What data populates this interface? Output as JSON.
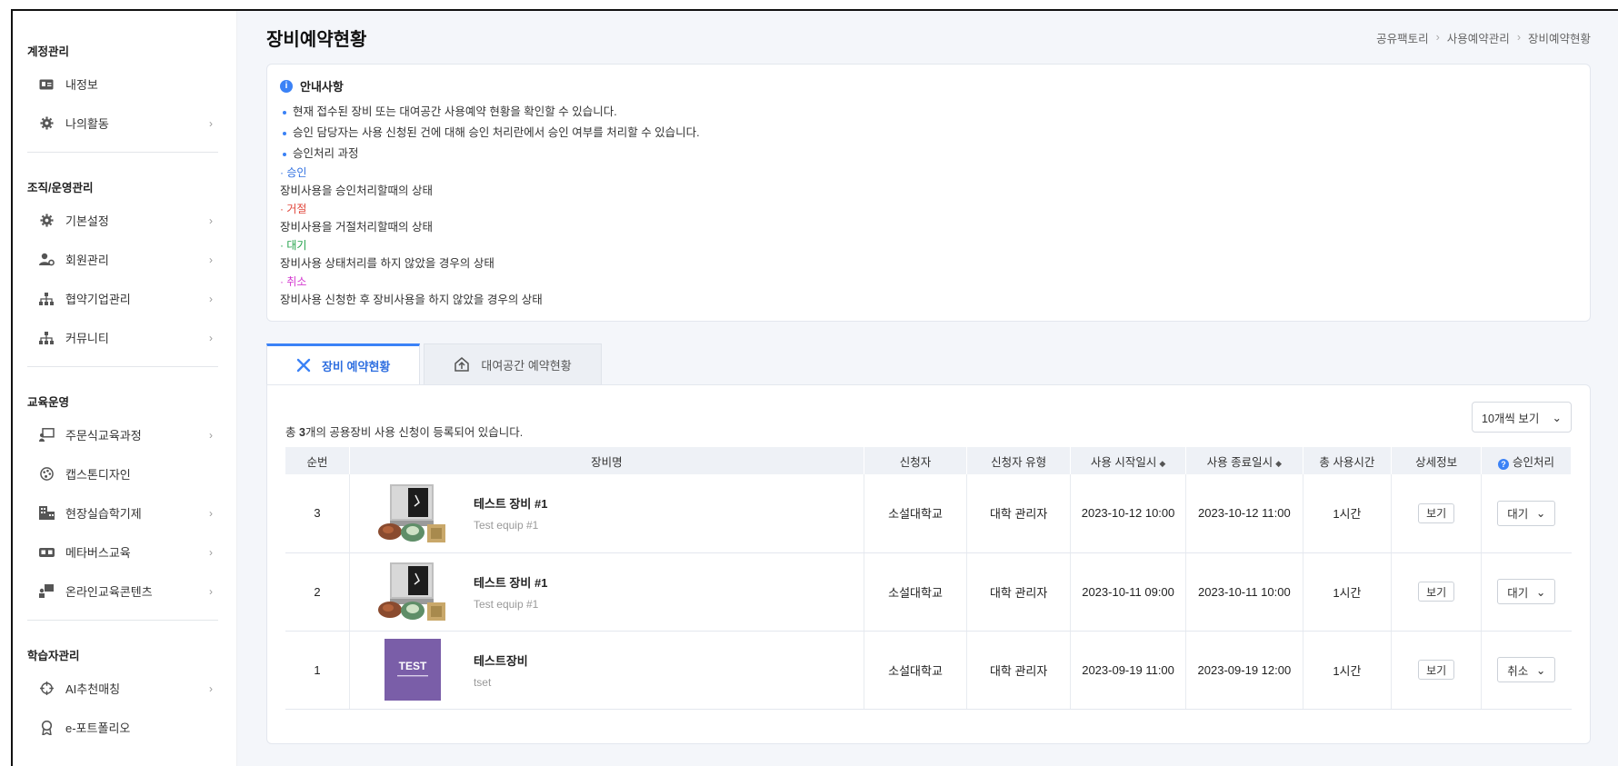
{
  "sidebar": {
    "sections": [
      {
        "heading": "계정관리",
        "items": [
          {
            "label": "내정보",
            "icon": "id-card-icon"
          },
          {
            "label": "나의활동",
            "icon": "gear-icon"
          }
        ]
      },
      {
        "heading": "조직/운영관리",
        "items": [
          {
            "label": "기본설정",
            "icon": "gear-icon"
          },
          {
            "label": "회원관리",
            "icon": "user-gear-icon"
          },
          {
            "label": "협약기업관리",
            "icon": "org-chart-icon"
          },
          {
            "label": "커뮤니티",
            "icon": "org-chart-icon"
          }
        ]
      },
      {
        "heading": "교육운영",
        "items": [
          {
            "label": "주문식교육과정",
            "icon": "presentation-icon"
          },
          {
            "label": "캡스톤디자인",
            "icon": "palette-icon"
          },
          {
            "label": "현장실습학기제",
            "icon": "building-icon"
          },
          {
            "label": "메타버스교육",
            "icon": "vr-goggles-icon"
          },
          {
            "label": "온라인교육콘텐츠",
            "icon": "user-board-icon"
          }
        ]
      },
      {
        "heading": "학습자관리",
        "items": [
          {
            "label": "AI추천매칭",
            "icon": "crosshair-icon"
          },
          {
            "label": "e-포트폴리오",
            "icon": "medal-icon"
          }
        ]
      }
    ]
  },
  "header": {
    "title": "장비예약현황",
    "breadcrumb": [
      "공유팩토리",
      "사용예약관리",
      "장비예약현황"
    ]
  },
  "notice": {
    "title": "안내사항",
    "bullets": [
      "현재 접수된 장비 또는 대여공간 사용예약 현황을 확인할 수 있습니다.",
      "승인 담당자는 사용 신청된 건에 대해 승인 처리란에서 승인 여부를 처리할 수 있습니다.",
      "승인처리 과정"
    ],
    "statuses": [
      {
        "label": "· 승인",
        "desc": "장비사용을 승인처리할때의 상태",
        "color": "#2f6fe0"
      },
      {
        "label": "· 거절",
        "desc": "장비사용을 거절처리할때의 상태",
        "color": "#e0453a"
      },
      {
        "label": "· 대기",
        "desc": "장비사용 상태처리를 하지 않았을 경우의 상태",
        "color": "#22a24a"
      },
      {
        "label": "· 취소",
        "desc": "장비사용 신청한 후 장비사용을 하지 않았을 경우의 상태",
        "color": "#d43ad0"
      }
    ]
  },
  "tabs": [
    {
      "label": "장비 예약현황",
      "icon": "tools-icon",
      "active": true
    },
    {
      "label": "대여공간 예약현황",
      "icon": "house-upload-icon",
      "active": false
    }
  ],
  "list": {
    "count_prefix": "총 ",
    "count": "3",
    "count_suffix": "개의 공용장비 사용 신청이 등록되어 있습니다.",
    "page_size": "10개씩 보기",
    "columns": [
      "순번",
      "장비명",
      "신청자",
      "신청자 유형",
      "사용 시작일시",
      "사용 종료일시",
      "총 사용시간",
      "상세정보",
      "승인처리"
    ],
    "rows": [
      {
        "no": "3",
        "name": "테스트 장비 #1",
        "sub": "Test equip #1",
        "thumb": "machine",
        "applicant": "소설대학교",
        "type": "대학 관리자",
        "start": "2023-10-12 10:00",
        "end": "2023-10-12 11:00",
        "total": "1시간",
        "detail": "보기",
        "status": "대기"
      },
      {
        "no": "2",
        "name": "테스트 장비 #1",
        "sub": "Test equip #1",
        "thumb": "machine",
        "applicant": "소설대학교",
        "type": "대학 관리자",
        "start": "2023-10-11 09:00",
        "end": "2023-10-11 10:00",
        "total": "1시간",
        "detail": "보기",
        "status": "대기"
      },
      {
        "no": "1",
        "name": "테스트장비",
        "sub": "tset",
        "thumb": "test",
        "thumb_text": "TEST",
        "applicant": "소설대학교",
        "type": "대학 관리자",
        "start": "2023-09-19 11:00",
        "end": "2023-09-19 12:00",
        "total": "1시간",
        "detail": "보기",
        "status": "취소"
      }
    ]
  },
  "colors": {
    "accent": "#3b82f6",
    "bg": "#f4f6fa",
    "test_thumb": "#7a5ea8"
  }
}
